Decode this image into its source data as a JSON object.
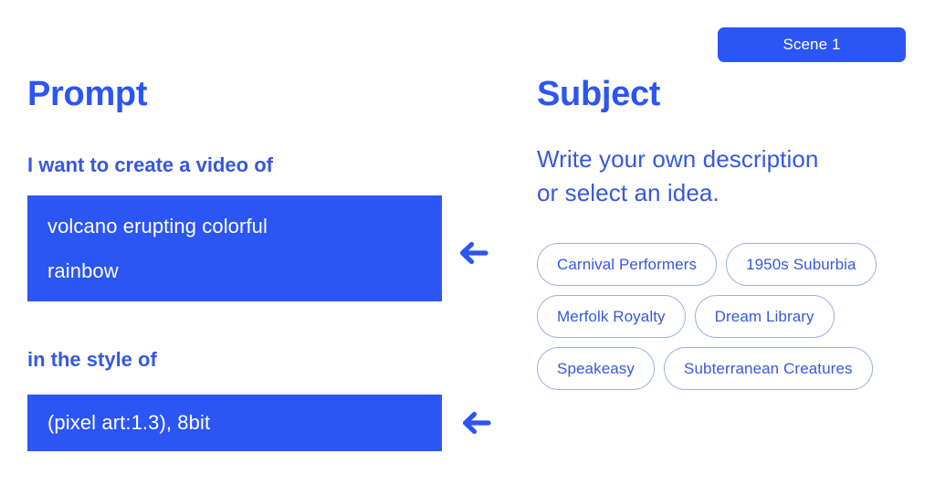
{
  "theme": {
    "accent_blue": "#2b55f5",
    "text_blue": "#3558e0",
    "chip_border": "#9db0e6",
    "background": "#ffffff",
    "badge_text": "#ffffff"
  },
  "badge": {
    "label": "Scene 1"
  },
  "prompt": {
    "title": "Prompt",
    "fields": [
      {
        "label": "I want to create a video of",
        "value_lines": [
          "volcano erupting colorful",
          "rainbow"
        ],
        "arrow_icon": "arrow-left-icon"
      },
      {
        "label": "in the style of",
        "value_lines": [
          "(pixel art:1.3), 8bit"
        ],
        "arrow_icon": "arrow-left-icon"
      }
    ]
  },
  "subject": {
    "title": "Subject",
    "description_lines": [
      "Write your own description",
      "or select an idea."
    ],
    "ideas": [
      "Carnival Performers",
      "1950s Suburbia",
      "Merfolk Royalty",
      "Dream Library",
      "Speakeasy",
      "Subterranean Creatures"
    ]
  }
}
